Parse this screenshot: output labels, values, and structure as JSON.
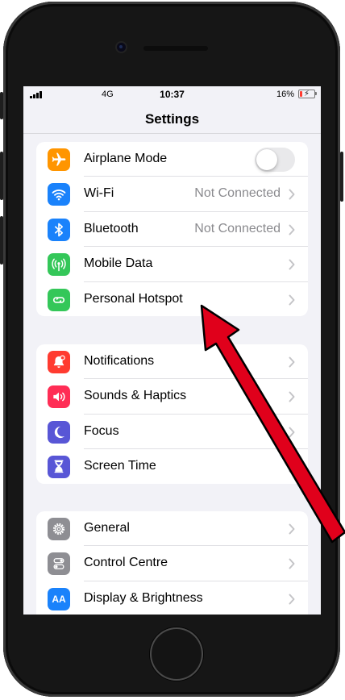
{
  "status_bar": {
    "network": "4G",
    "time": "10:37",
    "battery": "16%"
  },
  "nav": {
    "title": "Settings"
  },
  "groups": [
    {
      "items": [
        {
          "label": "Airplane Mode",
          "icon": "airplane-icon",
          "color": "#ff9500",
          "control": "toggle",
          "toggle_on": false
        },
        {
          "label": "Wi-Fi",
          "icon": "wifi-icon",
          "color": "#1a82fb",
          "value": "Not Connected"
        },
        {
          "label": "Bluetooth",
          "icon": "bluetooth-icon",
          "color": "#1a82fb",
          "value": "Not Connected"
        },
        {
          "label": "Mobile Data",
          "icon": "antenna-icon",
          "color": "#34c759"
        },
        {
          "label": "Personal Hotspot",
          "icon": "hotspot-chain-icon",
          "color": "#34c759"
        }
      ]
    },
    {
      "items": [
        {
          "label": "Notifications",
          "icon": "bell-icon",
          "color": "#ff3b30"
        },
        {
          "label": "Sounds & Haptics",
          "icon": "speaker-icon",
          "color": "#ff2d55"
        },
        {
          "label": "Focus",
          "icon": "moon-icon",
          "color": "#5856d6"
        },
        {
          "label": "Screen Time",
          "icon": "hourglass-icon",
          "color": "#5856d6"
        }
      ]
    },
    {
      "items": [
        {
          "label": "General",
          "icon": "gear-icon",
          "color": "#8e8e93"
        },
        {
          "label": "Control Centre",
          "icon": "switches-icon",
          "color": "#8e8e93"
        },
        {
          "label": "Display & Brightness",
          "icon": "text-size-icon",
          "color": "#1a82fb",
          "icon_text": "AA"
        }
      ]
    }
  ],
  "annotation": {
    "arrow_color": "#e0001b"
  }
}
